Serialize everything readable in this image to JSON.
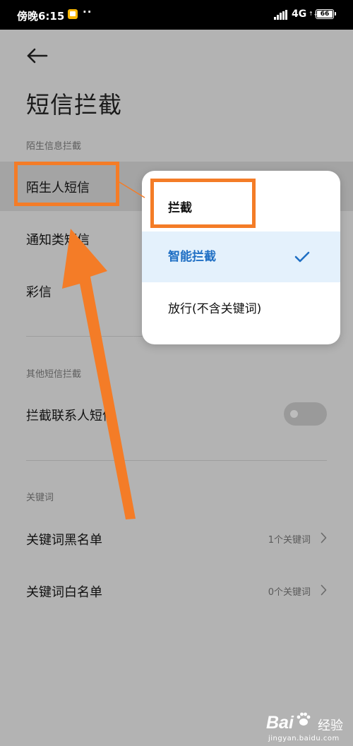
{
  "status_bar": {
    "time": "傍晚6:15",
    "more_indicator": "··",
    "network_type": "4G",
    "data_arrows": "↑↓",
    "battery_level": "66"
  },
  "header": {
    "title": "短信拦截"
  },
  "sections": {
    "stranger": {
      "header": "陌生信息拦截",
      "items": [
        {
          "label": "陌生人短信"
        },
        {
          "label": "通知类短信"
        },
        {
          "label": "彩信"
        }
      ]
    },
    "other": {
      "header": "其他短信拦截",
      "items": [
        {
          "label": "拦截联系人短信",
          "toggle_on": false
        }
      ]
    },
    "keywords": {
      "header": "关键词",
      "items": [
        {
          "label": "关键词黑名单",
          "value": "1个关键词"
        },
        {
          "label": "关键词白名单",
          "value": "0个关键词"
        }
      ]
    }
  },
  "popup_menu": {
    "items": [
      {
        "label": "拦截",
        "selected": false
      },
      {
        "label": "智能拦截",
        "selected": true
      },
      {
        "label": "放行(不含关键词)",
        "selected": false
      }
    ]
  },
  "watermark": {
    "logo": "Bai",
    "logo_suffix": "经验",
    "url": "jingyan.baidu.com"
  },
  "colors": {
    "annotation": "#f47c27",
    "selected_text": "#1f6fc4",
    "selected_background": "#e4f1fc",
    "dim_background": "#b3b3b3"
  },
  "icons": {
    "back": "arrow-left-icon",
    "check": "check-icon",
    "chevron": "chevron-right-icon",
    "watermark_paw": "paw-icon"
  }
}
